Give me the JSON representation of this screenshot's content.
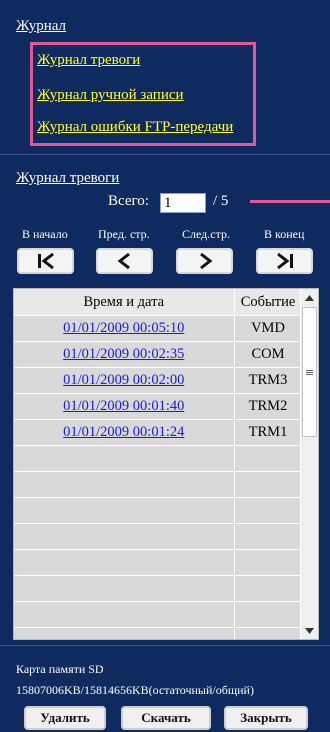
{
  "journal": {
    "title": "Журнал",
    "links": [
      "Журнал тревоги",
      "Журнал ручной записи",
      "Журнал ошибки FTP-передачи"
    ]
  },
  "section_title": "Журнал тревоги",
  "pager": {
    "total_label": "Всего:",
    "page_value": "1",
    "page_total": "/ 5",
    "labels": {
      "first": "В начало",
      "prev": "Пред. стр.",
      "next": "След.стр.",
      "last": "В конец"
    }
  },
  "table": {
    "columns": [
      "Время и дата",
      "Событие"
    ],
    "rows": [
      {
        "time": "01/01/2009 00:05:10",
        "event": "VMD"
      },
      {
        "time": "01/01/2009 00:02:35",
        "event": "COM"
      },
      {
        "time": "01/01/2009 00:02:00",
        "event": "TRM3"
      },
      {
        "time": "01/01/2009 00:01:40",
        "event": "TRM2"
      },
      {
        "time": "01/01/2009 00:01:24",
        "event": "TRM1"
      }
    ]
  },
  "sd": {
    "label": "Карта памяти SD",
    "usage": "15807006KB/15814656KB(остаточный/общий)"
  },
  "buttons": {
    "delete": "Удалить",
    "download": "Скачать",
    "close": "Закрыть"
  },
  "colors": {
    "background": "#0f2a5e",
    "highlight": "#e0589a",
    "link_yellow": "#ffff33",
    "table_link": "#1a1ae0"
  }
}
